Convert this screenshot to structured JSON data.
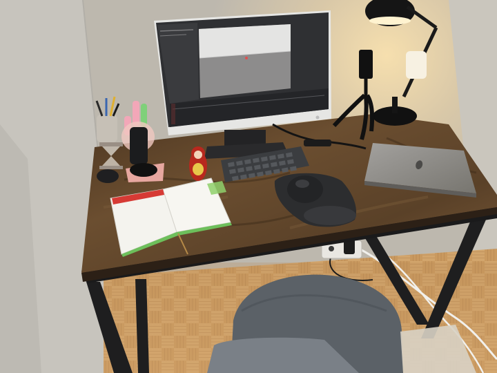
{
  "scene": {
    "subject": "home-office-desk",
    "objects": [
      {
        "name": "monitor",
        "brand_mark": "hp",
        "screen_content": "3d-editor-viewport"
      },
      {
        "name": "keyboard",
        "color": "#3b3d40"
      },
      {
        "name": "mouse",
        "color": "#232426"
      },
      {
        "name": "mouse-pad",
        "color": "#2c2d2f"
      },
      {
        "name": "laptop",
        "color": "#8d8b89"
      },
      {
        "name": "desk-lamp",
        "color": "#151515"
      },
      {
        "name": "phone-tripod",
        "color": "#111111"
      },
      {
        "name": "notebook",
        "color": "#f4f3ee"
      },
      {
        "name": "pen-holder"
      },
      {
        "name": "hourglass"
      },
      {
        "name": "matryoshka-doll",
        "color": "#b8281e"
      },
      {
        "name": "power-strip",
        "color": "#e9e7e2"
      },
      {
        "name": "chair",
        "color": "#5b6167"
      }
    ],
    "colors": {
      "wall": "#cfcbc2",
      "lamp_glow": "#f3d9a8",
      "desk_top": "#5a4128",
      "desk_frame": "#1e1e1f",
      "floor": "#c99a62"
    }
  }
}
